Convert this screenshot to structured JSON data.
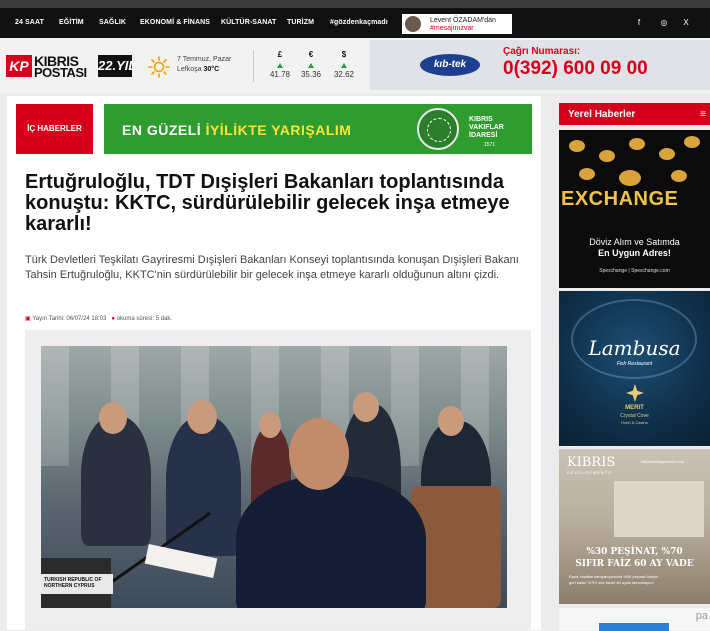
{
  "nav": {
    "items": [
      "24 SAAT",
      "EĞİTİM",
      "SAĞLIK",
      "EKONOMİ & FİNANS",
      "KÜLTÜR-SANAT",
      "TURİZM",
      "#gözdenkaçmadı"
    ],
    "highlight_line1": "Levent ÖZADAM'dan",
    "highlight_line2": "#mesajınızvar",
    "social_icons": [
      "facebook-icon",
      "instagram-icon",
      "x-icon"
    ],
    "social_glyphs": [
      "f",
      "◎",
      "X"
    ]
  },
  "header": {
    "logo_kp": "KP",
    "logo_line1": "KIBRIS",
    "logo_line2": "POSTASI",
    "logo_years": "22.YIL",
    "weather_date": "7 Temmuz, Pazar",
    "weather_city": "Lefkoşa",
    "weather_temp": "30°C",
    "fx": [
      {
        "symbol": "£",
        "value": "41.78"
      },
      {
        "symbol": "€",
        "value": "35.36"
      },
      {
        "symbol": "$",
        "value": "32.62"
      }
    ],
    "kibtek_logo": "kıb-tek",
    "call_label": "Çağrı Numarası:",
    "call_number": "0(392) 600 09 00"
  },
  "article": {
    "category": "İÇ HABERLER",
    "banner_text_a": "EN GÜZELİ",
    "banner_text_b": "İYİLİKTE YARIŞALIM",
    "banner_org1": "KIBRIS",
    "banner_org2": "VAKIFLAR",
    "banner_org3": "İDARESİ",
    "banner_year": "1571",
    "headline": "Ertuğruloğlu, TDT Dışişleri Bakanları toplantısında konuştu: KKTC, sürdürülebilir gelecek inşa etmeye kararlı!",
    "summary": "Türk Devletleri Teşkilatı Gayriresmi Dışişleri Bakanları Konseyi toplantısında konuşan Dışişleri Bakanı Tahsin Ertuğruloğlu, KKTC'nin sürdürülebilir bir gelecek inşa etmeye kararlı olduğunun altını çizdi.",
    "publish_label": "Yayın Tarihi: 06/07/24 18:03",
    "read_time": "okuma süresi: 5 dak.",
    "photo_flag_card": "TURKISH REPUBLIC OF NORTHERN CYPRUS"
  },
  "sidebar": {
    "title": "Yerel Haberler",
    "ad1_brand": "EXCHANGE",
    "ad1_line1": "Döviz Alım ve Satımda",
    "ad1_line2": "En Uygun Adres!",
    "ad1_foot": "Spexchange | Spexchange.com",
    "ad2_brand": "Lambusa",
    "ad2_sub": "Fish Restaurant",
    "ad2_merit": "MERIT",
    "ad2_crystal": "Crystal Cove",
    "ad2_hotel": "Hotel & Casino",
    "ad3_brand": "KIBRIS",
    "ad3_dev": "DEVELOPMENTS",
    "ad3_url": "kibrisdevelopments.com",
    "ad3_main1": "%30 PEŞİNAT, %70",
    "ad3_main2": "SIFIR FAİZ 60 AY VADE",
    "ad3_small1": "Eşsiz fırsatlar kampanyamızla %30 peşinat ödeyin",
    "ad3_small2": "geri kalan %70'i sıfır faizle 60 ayda tamamlayın!",
    "ad4_text": "pa"
  }
}
